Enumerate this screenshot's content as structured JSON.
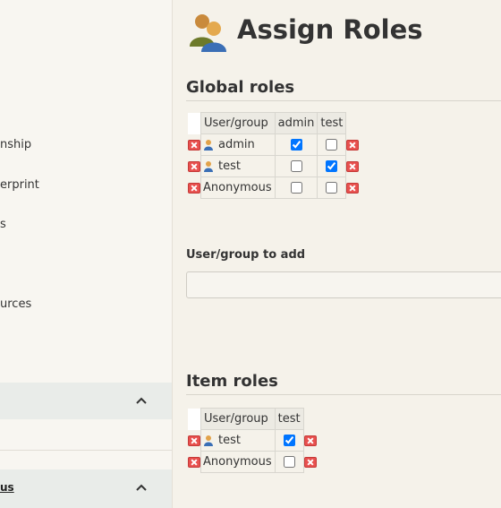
{
  "page": {
    "title": "Assign Roles"
  },
  "sidebar": {
    "items": [
      {
        "label": "nship"
      },
      {
        "label": "erprint"
      },
      {
        "label": "s"
      },
      {
        "label": "urces"
      }
    ],
    "panel_label": "us"
  },
  "global_roles": {
    "title": "Global roles",
    "header": {
      "user_group": "User/group",
      "roles": [
        "admin",
        "test"
      ]
    },
    "rows": [
      {
        "name": "admin",
        "is_user": true,
        "checks": [
          true,
          false
        ]
      },
      {
        "name": "test",
        "is_user": true,
        "checks": [
          false,
          true
        ]
      },
      {
        "name": "Anonymous",
        "is_user": false,
        "checks": [
          false,
          false
        ]
      }
    ]
  },
  "add_field": {
    "label": "User/group to add",
    "value": ""
  },
  "item_roles": {
    "title": "Item roles",
    "header": {
      "user_group": "User/group",
      "roles": [
        "test"
      ]
    },
    "rows": [
      {
        "name": "test",
        "is_user": true,
        "checks": [
          true
        ]
      },
      {
        "name": "Anonymous",
        "is_user": false,
        "checks": [
          false
        ]
      }
    ]
  },
  "icons": {
    "delete": "delete-x-icon",
    "user": "user-icon",
    "roles_title": "users-group-icon",
    "collapse": "chevron-up-icon"
  },
  "colors": {
    "background": "#f5f2ea",
    "delete": "#e8504e",
    "checkbox_accent": "#1a73e8"
  }
}
